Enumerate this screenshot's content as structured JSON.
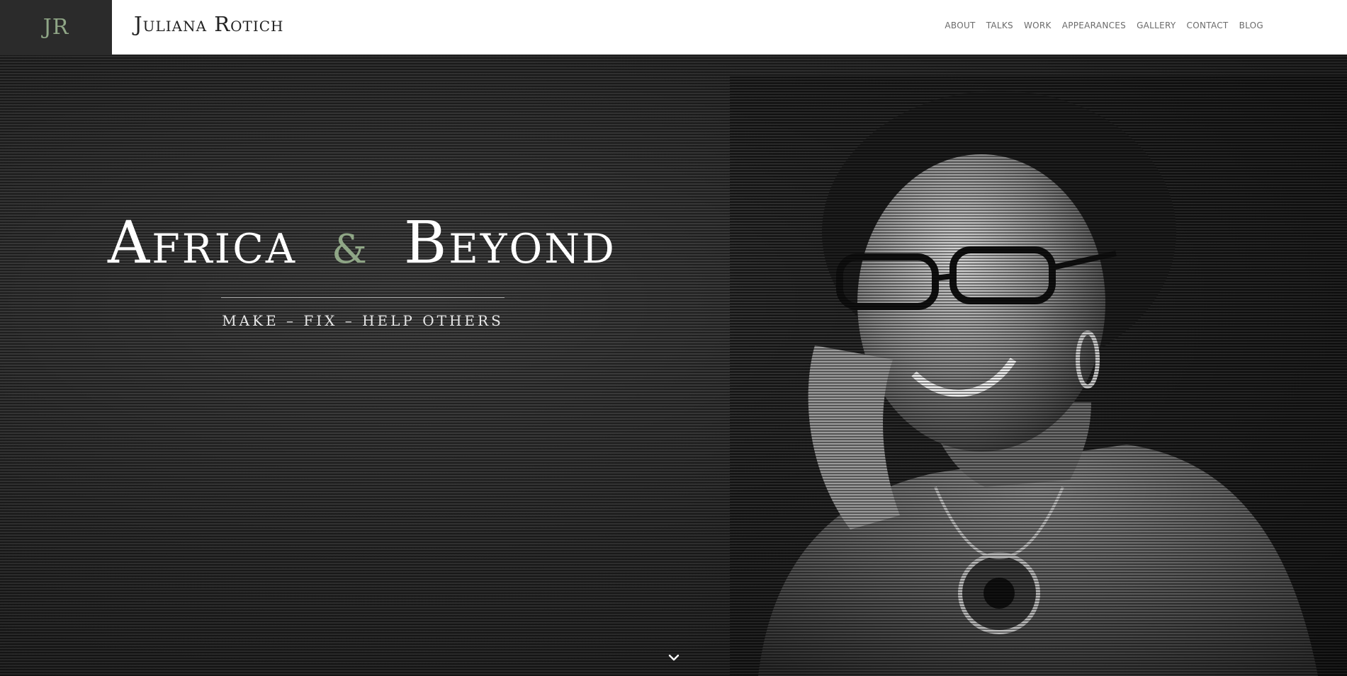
{
  "header": {
    "logo_text": "JR",
    "site_title": "Juliana Rotich",
    "nav": [
      "ABOUT",
      "TALKS",
      "WORK",
      "APPEARANCES",
      "GALLERY",
      "CONTACT",
      "BLOG"
    ]
  },
  "hero": {
    "headline_left": "Africa",
    "headline_amp": "&",
    "headline_right": "Beyond",
    "tagline": "MAKE – FIX – HELP OTHERS",
    "scroll_icon": "chevron-down-icon"
  },
  "colors": {
    "accent": "#8fa686",
    "logo_bg": "#2b2b2b",
    "header_bg": "#ffffff",
    "hero_bg": "#262626"
  }
}
